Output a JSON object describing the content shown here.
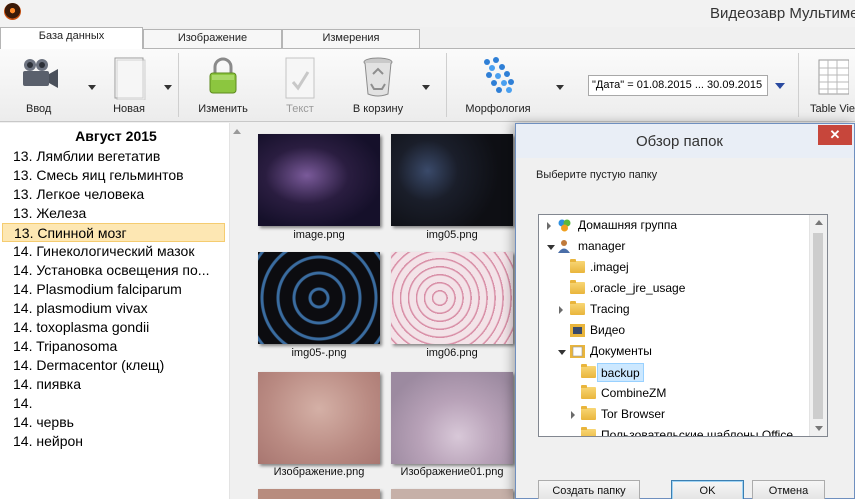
{
  "window": {
    "title": "Видеозавр Мультиме"
  },
  "tabs": [
    "База данных",
    "Изображение",
    "Измерения"
  ],
  "toolbar": {
    "input_label": "Ввод",
    "new_label": "Новая",
    "edit_label": "Изменить",
    "text_label": "Текст",
    "trash_label": "В корзину",
    "morph_label": "Морфология",
    "filter_value": "\"Дата\" = 01.08.2015 ... 30.09.2015",
    "table_label": "Table Vie"
  },
  "list": {
    "header": "Август 2015",
    "items": [
      {
        "label": "13.  Лямблии вегетатив"
      },
      {
        "label": "13.  Смесь яиц гельминтов"
      },
      {
        "label": "13.  Легкое человека"
      },
      {
        "label": "13.  Железа"
      },
      {
        "label": "13.  Спинной мозг"
      },
      {
        "label": "14.  Гинекологический мазок"
      },
      {
        "label": "14.  Установка освещения по..."
      },
      {
        "label": "14.  Plasmodium falciparum"
      },
      {
        "label": "14.  plasmodium vivax"
      },
      {
        "label": "14.  toxoplasma gondii"
      },
      {
        "label": "14.  Tripanosoma"
      },
      {
        "label": "14.  Dermacentor (клещ)"
      },
      {
        "label": "14.  пиявка"
      },
      {
        "label": "14."
      },
      {
        "label": "14.  червь"
      },
      {
        "label": "14.  нейрон"
      }
    ],
    "selected_index": 4
  },
  "thumbnails": [
    {
      "caption": "image.png"
    },
    {
      "caption": "img05.png"
    },
    {
      "caption": "img05-.png"
    },
    {
      "caption": "img06.png"
    },
    {
      "caption": "Изображение.png"
    },
    {
      "caption": "Изображение01.png"
    }
  ],
  "dialog": {
    "title": "Обзор папок",
    "close_glyph": "✕",
    "description": "Выберите пустую папку",
    "tree": [
      {
        "label": "Домашняя группа"
      },
      {
        "label": "manager"
      },
      {
        "label": ".imagej"
      },
      {
        "label": ".oracle_jre_usage"
      },
      {
        "label": "Tracing"
      },
      {
        "label": "Видео"
      },
      {
        "label": "Документы"
      },
      {
        "label": "backup"
      },
      {
        "label": "CombineZM"
      },
      {
        "label": "Tor Browser"
      },
      {
        "label": "Пользовательские шаблоны Office"
      }
    ],
    "buttons": {
      "create": "Создать папку",
      "ok": "OK",
      "cancel": "Отмена"
    }
  }
}
